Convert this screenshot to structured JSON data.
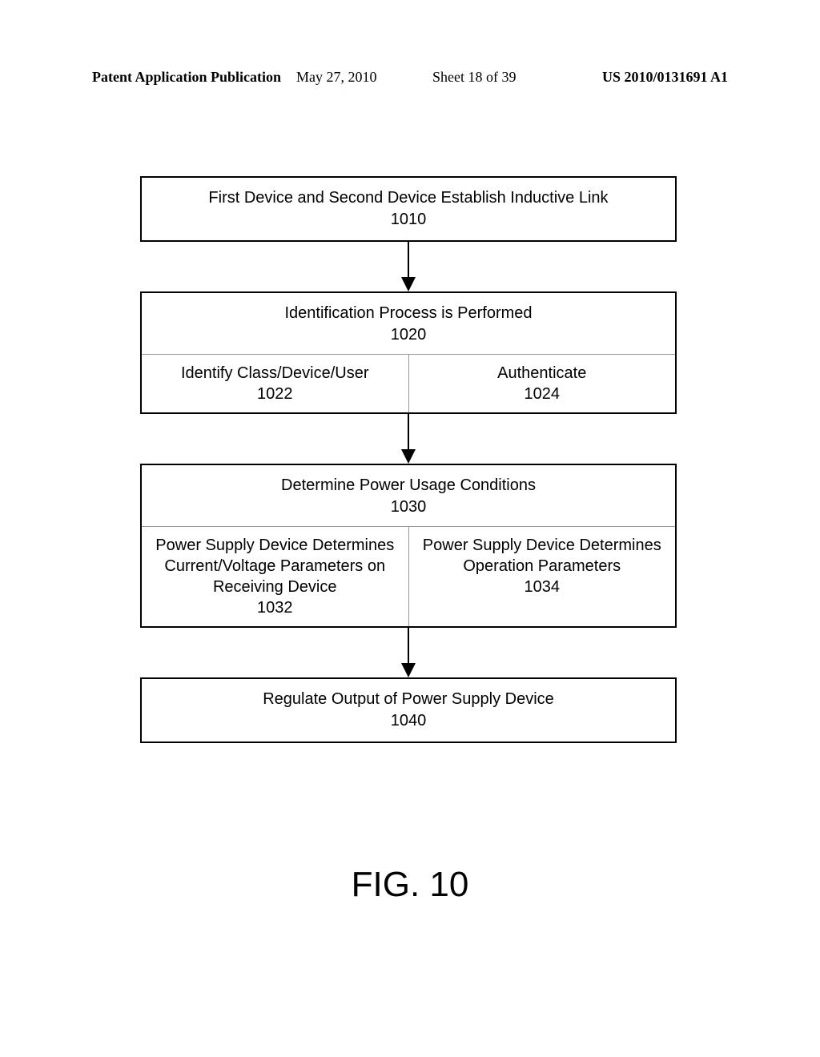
{
  "header": {
    "left": "Patent Application Publication",
    "date": "May 27, 2010",
    "sheet": "Sheet 18 of 39",
    "right": "US 2010/0131691 A1"
  },
  "flow": {
    "step1": {
      "text": "First Device and Second Device Establish Inductive Link",
      "num": "1010"
    },
    "step2": {
      "text": "Identification Process is Performed",
      "num": "1020",
      "left": {
        "text": "Identify Class/Device/User",
        "num": "1022"
      },
      "right": {
        "text": "Authenticate",
        "num": "1024"
      }
    },
    "step3": {
      "text": "Determine Power Usage Conditions",
      "num": "1030",
      "left": {
        "text": "Power Supply Device Determines Current/Voltage Parameters on Receiving Device",
        "num": "1032"
      },
      "right": {
        "text": "Power Supply Device Determines Operation Parameters",
        "num": "1034"
      }
    },
    "step4": {
      "text": "Regulate Output of Power Supply Device",
      "num": "1040"
    }
  },
  "figure_label": "FIG. 10"
}
